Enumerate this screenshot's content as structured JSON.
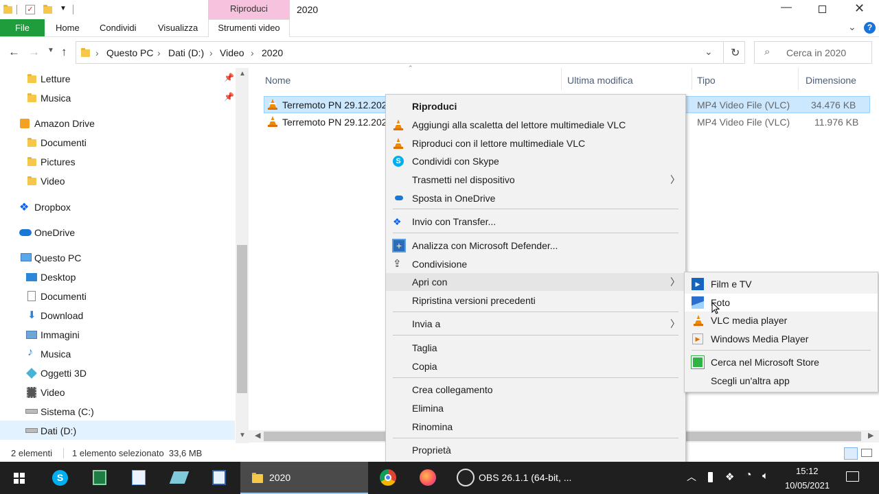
{
  "titlebar": {
    "contextual_tab": "Riproduci",
    "title": "2020"
  },
  "ribbon": {
    "tabs": [
      "File",
      "Home",
      "Condividi",
      "Visualizza",
      "Strumenti video"
    ]
  },
  "address": {
    "crumbs": [
      "Questo PC",
      "Dati (D:)",
      "Video",
      "2020"
    ],
    "search_placeholder": "Cerca in 2020"
  },
  "nav": {
    "items": [
      "Letture",
      "Musica",
      "Amazon Drive",
      "Documenti",
      "Pictures",
      "Video",
      "Dropbox",
      "OneDrive",
      "Questo PC",
      "Desktop",
      "Documenti",
      "Download",
      "Immagini",
      "Musica",
      "Oggetti 3D",
      "Video",
      "Sistema (C:)",
      "Dati (D:)"
    ]
  },
  "columns": {
    "name": "Nome",
    "modified": "Ultima modifica",
    "type": "Tipo",
    "size": "Dimensione"
  },
  "files": [
    {
      "name": "Terremoto PN 29.12.2020",
      "type": "MP4 Video File (VLC)",
      "size": "34.476 KB"
    },
    {
      "name": "Terremoto PN 29.12.2020",
      "type": "MP4 Video File (VLC)",
      "size": "11.976 KB"
    }
  ],
  "context_menu": {
    "items": [
      "Riproduci",
      "Aggiungi alla scaletta del lettore multimediale VLC",
      "Riproduci con il lettore multimediale VLC",
      "Condividi con Skype",
      "Trasmetti nel dispositivo",
      "Sposta in OneDrive",
      "Invio con Transfer...",
      "Analizza con Microsoft Defender...",
      "Condivisione",
      "Apri con",
      "Ripristina versioni precedenti",
      "Invia a",
      "Taglia",
      "Copia",
      "Crea collegamento",
      "Elimina",
      "Rinomina",
      "Proprietà"
    ]
  },
  "submenu": {
    "items": [
      "Film e TV",
      "Foto",
      "VLC media player",
      "Windows Media Player",
      "Cerca nel Microsoft Store",
      "Scegli un'altra app"
    ]
  },
  "status": {
    "count": "2 elementi",
    "selection": "1 elemento selezionato  33,6 MB"
  },
  "taskbar": {
    "explorer_label": "2020",
    "obs_label": "OBS 26.1.1 (64-bit, ...",
    "time": "15:12",
    "date": "10/05/2021"
  },
  "colors": {
    "file_tab": "#1f9c3c",
    "contextual": "#f7c2dd",
    "selection": "#cce8ff",
    "taskbar": "#1f1f1f"
  }
}
